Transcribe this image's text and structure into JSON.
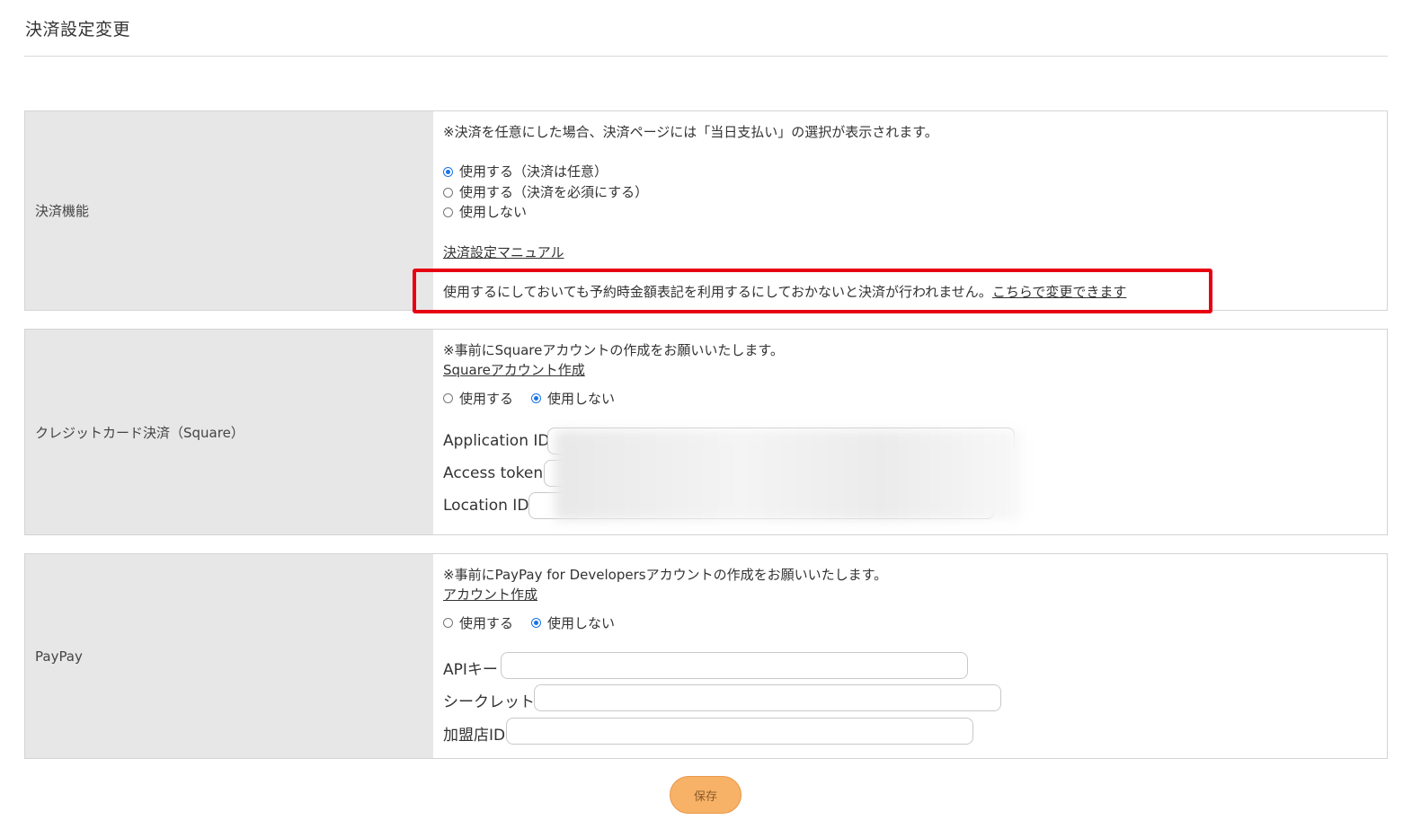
{
  "page": {
    "title": "決済設定変更"
  },
  "payment_function": {
    "label": "決済機能",
    "note": "※決済を任意にした場合、決済ページには「当日支払い」の選択が表示されます。",
    "options": [
      {
        "label": "使用する（決済は任意）",
        "checked": true
      },
      {
        "label": "使用する（決済を必須にする）",
        "checked": false
      },
      {
        "label": "使用しない",
        "checked": false
      }
    ],
    "manual_link": "決済設定マニュアル",
    "warning_text": "使用するにしておいても予約時金額表記を利用するにしておかないと決済が行われません。",
    "warning_link": "こちらで変更できます"
  },
  "square": {
    "label": "クレジットカード決済（Square）",
    "note": "※事前にSquareアカウントの作成をお願いいたします。",
    "account_link": "Squareアカウント作成",
    "options": [
      {
        "label": "使用する",
        "checked": false
      },
      {
        "label": "使用しない",
        "checked": true
      }
    ],
    "fields": {
      "application_id": "Application ID",
      "access_token": "Access token",
      "location_id": "Location ID"
    }
  },
  "paypay": {
    "label": "PayPay",
    "note": "※事前にPayPay for Developersアカウントの作成をお願いいたします。",
    "account_link": "アカウント作成",
    "options": [
      {
        "label": "使用する",
        "checked": false
      },
      {
        "label": "使用しない",
        "checked": true
      }
    ],
    "fields": {
      "api_key": "APIキー",
      "secret": "シークレット",
      "merchant_id": "加盟店ID"
    }
  },
  "actions": {
    "save_label": "保存"
  },
  "colors": {
    "highlight": "#e60012",
    "save_button": "#f7b267",
    "radio_checked": "#1a73e8"
  }
}
